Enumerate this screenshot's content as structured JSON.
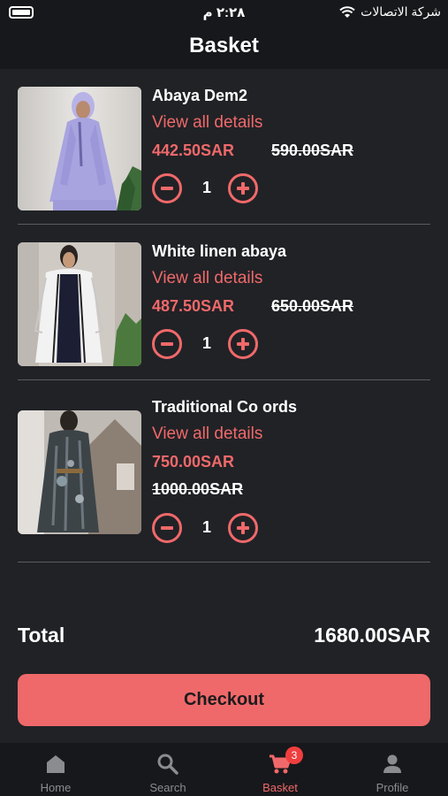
{
  "status_bar": {
    "carrier": "شركة الاتصالات",
    "time": "٢:٢٨ م"
  },
  "header": {
    "title": "Basket"
  },
  "basket": {
    "details_label": "View all details",
    "items": [
      {
        "name": "Abaya Dem2",
        "price": "442.50SAR",
        "old_price": "590.00SAR",
        "quantity": "1"
      },
      {
        "name": "White linen abaya",
        "price": "487.50SAR",
        "old_price": "650.00SAR",
        "quantity": "1"
      },
      {
        "name": "Traditional Co ords",
        "price": "750.00SAR",
        "old_price": "1000.00SAR",
        "quantity": "1"
      }
    ]
  },
  "summary": {
    "total_label": "Total",
    "total_value": "1680.00SAR"
  },
  "checkout": {
    "label": "Checkout"
  },
  "tabbar": {
    "tabs": [
      {
        "label": "Home",
        "icon": "home-icon"
      },
      {
        "label": "Search",
        "icon": "search-icon"
      },
      {
        "label": "Basket",
        "icon": "cart-icon",
        "badge": "3"
      },
      {
        "label": "Profile",
        "icon": "person-icon"
      }
    ]
  },
  "colors": {
    "accent": "#f0696a",
    "background": "#212226",
    "bar": "#17181b",
    "badge": "#f03e3e"
  }
}
